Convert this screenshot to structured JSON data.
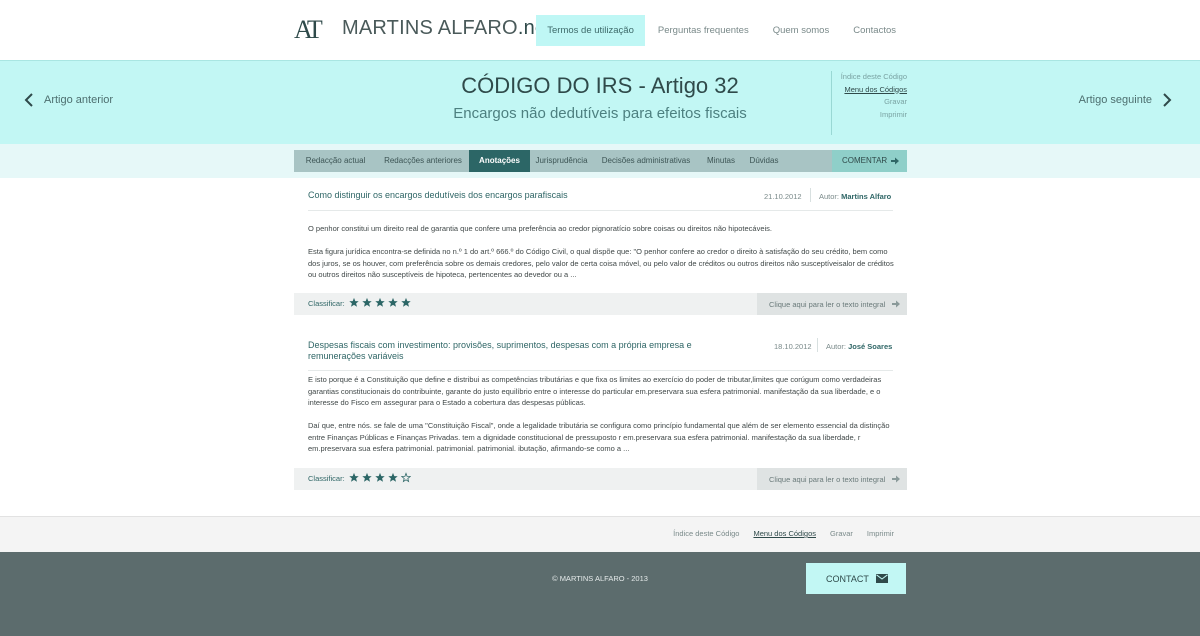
{
  "header": {
    "logo_mark": "AT",
    "site_name_part1": "MARTINS ALFARO",
    "site_name_part2": ".net",
    "nav": [
      {
        "label": "Termos de utilização",
        "active": true
      },
      {
        "label": "Perguntas frequentes",
        "active": false
      },
      {
        "label": "Quem somos",
        "active": false
      },
      {
        "label": "Contactos",
        "active": false
      }
    ]
  },
  "hero": {
    "title": "CÓDIGO DO IRS - Artigo 32",
    "subtitle": "Encargos não dedutíveis para efeitos fiscais",
    "prev_label": "Artigo anterior",
    "next_label": "Artigo seguinte",
    "side_links": [
      "Índice deste Código",
      "Menu dos Códigos",
      "Gravar",
      "Imprimir"
    ],
    "side_current": "Menu dos Códigos"
  },
  "tabs": {
    "items": [
      "Redacção actual",
      "Redacções anteriores",
      "Anotações",
      "Jurisprudência",
      "Decisões administrativas",
      "Minutas",
      "Dúvidas"
    ],
    "active": "Anotações",
    "comment_label": "COMENTAR"
  },
  "articles": [
    {
      "title": "Como distinguir os encargos dedutíveis dos encargos parafiscais",
      "date": "21.10.2012",
      "author_label": "Autor:",
      "author": "Martins Alfaro",
      "paragraphs": [
        "O penhor constitui um direito real de garantia que confere uma preferência ao credor pignoratício sobre coisas ou direitos não hipotecáveis.",
        "Esta figura jurídica encontra-se definida no n.º 1 do art.º 666.º do Código Civil, o qual dispõe que: \"O penhor confere ao credor o direito à satisfação do seu crédito, bem como dos juros, se os houver, com preferência sobre os demais credores, pelo valor de certa coisa móvel, ou pelo valor de créditos ou outros direitos não susceptíveisalor de créditos ou outros direitos não susceptíveis de hipoteca, pertencentes ao devedor ou a ..."
      ],
      "rating_label": "Classificar:",
      "rating": 5,
      "read_more": "Clique aqui para ler o texto integral"
    },
    {
      "title": "Despesas fiscais com investimento: provisões, suprimentos, despesas com a própria empresa e remunerações variáveis",
      "date": "18.10.2012",
      "author_label": "Autor:",
      "author": "José Soares",
      "paragraphs": [
        "E isto porque é a Constituição que define e distribui as competências tributárias e que fixa os limites ao exercício do poder de tributar,limites que corúgum como verdadeiras garantias constitucionais do contribuinte, garante do justo equilíbrio entre o interesse do particular em.preservara sua esfera patrimonial. manifestação da sua liberdade, e o interesse do Fisco em assegurar para o Estado a cobertura das despesas públicas.",
        "Daí que, entre nós. se fale de uma \"Constituição Fiscal\", onde a legalidade tributária se configura como princípio fundamental que além de ser elemento essencial da distinção entre Finanças Públicas e Finanças Privadas. tem a dignidade constitucional de pressuposto r em.preservara sua esfera patrimonial. manifestação da sua liberdade, r em.preservara sua esfera patrimonial. patrimonial. patrimonial. ibutação, afirmando-se como a ..."
      ],
      "rating_label": "Classificar:",
      "rating": 4,
      "read_more": "Clique aqui para ler o texto integral"
    }
  ],
  "footer_nav": {
    "links": [
      "Índice deste Código",
      "Menu dos Códigos",
      "Gravar",
      "Imprimir"
    ],
    "current": "Menu dos Códigos"
  },
  "footer": {
    "copyright": "© MARTINS ALFARO - 2013",
    "contact_label": "CONTACT"
  },
  "colors": {
    "accent_light": "#c2f7f4",
    "accent_dark": "#2c6666",
    "footer_bg": "#5c6c6d"
  }
}
